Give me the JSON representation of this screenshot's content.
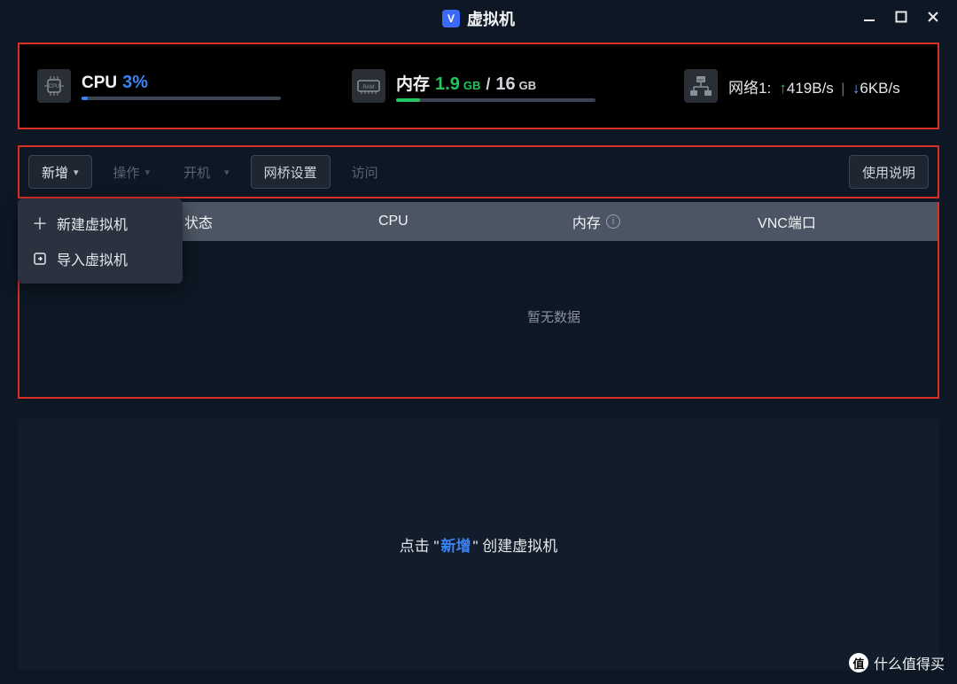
{
  "window": {
    "title": "虚拟机",
    "logo_letter": "V"
  },
  "stats": {
    "cpu": {
      "label": "CPU",
      "value": "3%",
      "percent": 3
    },
    "memory": {
      "label": "内存",
      "used": "1.9",
      "used_unit": "GB",
      "total": "16",
      "total_unit": "GB",
      "percent": 12
    },
    "network": {
      "label": "网络1:",
      "up": "419B/s",
      "down": "6KB/s"
    }
  },
  "toolbar": {
    "add": "新增",
    "operate": "操作",
    "power": "开机",
    "bridge": "网桥设置",
    "access": "访问",
    "help": "使用说明"
  },
  "dropdown": {
    "new_vm": "新建虚拟机",
    "import_vm": "导入虚拟机"
  },
  "table": {
    "headers": {
      "status": "状态",
      "cpu": "CPU",
      "memory": "内存",
      "vnc": "VNC端口"
    },
    "empty": "暂无数据"
  },
  "panel": {
    "hint_pre": "点击 \"",
    "hint_key": "新增",
    "hint_post": "\" 创建虚拟机"
  },
  "watermark": {
    "badge": "值",
    "text": "什么值得买"
  }
}
